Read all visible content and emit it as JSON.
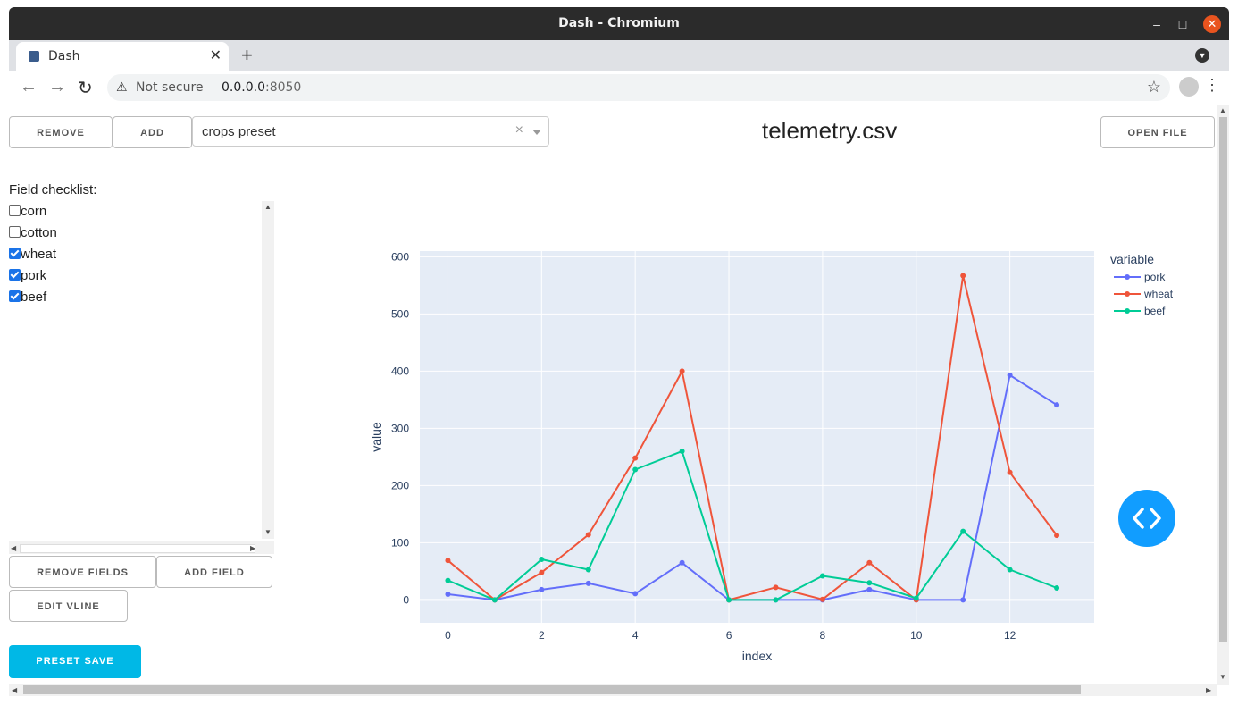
{
  "window": {
    "title": "Dash - Chromium"
  },
  "tab": {
    "title": "Dash"
  },
  "address": {
    "security": "Not secure",
    "host": "0.0.0.0",
    "port": ":8050"
  },
  "toolbar": {
    "remove_label": "REMOVE",
    "add_label": "ADD",
    "open_file_label": "OPEN FILE",
    "preset_value": "crops preset",
    "file_name": "telemetry.csv"
  },
  "fields": {
    "label": "Field checklist:",
    "items": [
      {
        "label": "corn",
        "checked": false
      },
      {
        "label": "cotton",
        "checked": false
      },
      {
        "label": "wheat",
        "checked": true
      },
      {
        "label": "pork",
        "checked": true
      },
      {
        "label": "beef",
        "checked": true
      }
    ],
    "remove_fields_label": "REMOVE FIELDS",
    "add_field_label": "ADD FIELD",
    "edit_vline_label": "EDIT VLINE",
    "preset_save_label": "PRESET SAVE"
  },
  "chart_data": {
    "type": "line",
    "xlabel": "index",
    "ylabel": "value",
    "legend_title": "variable",
    "legend_position": "top-right",
    "xlim": [
      -0.6,
      13.8
    ],
    "ylim": [
      -40,
      610
    ],
    "x_ticks": [
      0,
      2,
      4,
      6,
      8,
      10,
      12
    ],
    "y_ticks": [
      0,
      100,
      200,
      300,
      400,
      500,
      600
    ],
    "grid": true,
    "x": [
      0,
      1,
      2,
      3,
      4,
      5,
      6,
      7,
      8,
      9,
      10,
      11,
      12,
      13
    ],
    "series": [
      {
        "name": "pork",
        "color": "#636efa",
        "values": [
          10,
          0,
          18,
          29,
          11,
          65,
          0,
          0,
          0,
          18,
          0,
          0,
          393,
          341
        ]
      },
      {
        "name": "wheat",
        "color": "#ef553b",
        "values": [
          69,
          0,
          48,
          114,
          248,
          400,
          0,
          22,
          1,
          65,
          0,
          567,
          223,
          113
        ]
      },
      {
        "name": "beef",
        "color": "#00cc96",
        "values": [
          34,
          0,
          71,
          53,
          228,
          260,
          0,
          0,
          42,
          30,
          3,
          120,
          53,
          21
        ]
      }
    ]
  }
}
